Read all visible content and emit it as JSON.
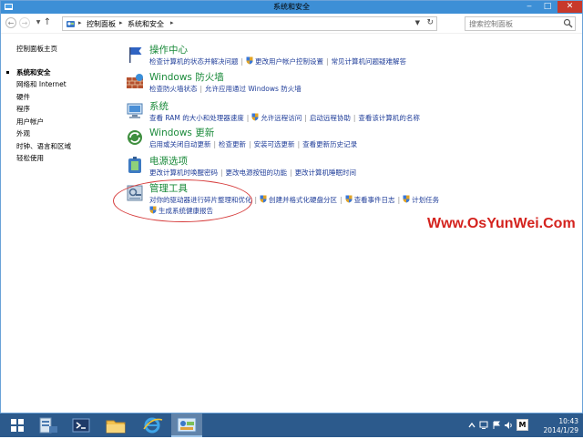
{
  "window": {
    "title": "系统和安全"
  },
  "address": {
    "crumbs": [
      "控制面板",
      "系统和安全"
    ],
    "search_placeholder": "搜索控制面板"
  },
  "sidebar": {
    "items": [
      {
        "label": "控制面板主页",
        "current": false
      },
      {
        "label": "系统和安全",
        "current": true
      },
      {
        "label": "网络和 Internet",
        "current": false
      },
      {
        "label": "硬件",
        "current": false
      },
      {
        "label": "程序",
        "current": false
      },
      {
        "label": "用户帐户",
        "current": false
      },
      {
        "label": "外观",
        "current": false
      },
      {
        "label": "时钟、语言和区域",
        "current": false
      },
      {
        "label": "轻松使用",
        "current": false
      }
    ]
  },
  "categories": [
    {
      "title": "操作中心",
      "icon": "flag-icon",
      "links": [
        {
          "text": "检查计算机的状态并解决问题",
          "shield": false
        },
        {
          "text": "更改用户帐户控制设置",
          "shield": true
        },
        {
          "text": "常见计算机问题疑难解答",
          "shield": false
        }
      ]
    },
    {
      "title": "Windows 防火墙",
      "icon": "firewall-icon",
      "links": [
        {
          "text": "检查防火墙状态",
          "shield": false
        },
        {
          "text": "允许应用通过 Windows 防火墙",
          "shield": false
        }
      ]
    },
    {
      "title": "系统",
      "icon": "computer-icon",
      "links": [
        {
          "text": "查看 RAM 的大小和处理器速度",
          "shield": false
        },
        {
          "text": "允许远程访问",
          "shield": true
        },
        {
          "text": "启动远程协助",
          "shield": false
        },
        {
          "text": "查看该计算机的名称",
          "shield": false
        }
      ]
    },
    {
      "title": "Windows 更新",
      "icon": "update-icon",
      "links": [
        {
          "text": "启用或关闭自动更新",
          "shield": false
        },
        {
          "text": "检查更新",
          "shield": false
        },
        {
          "text": "安装可选更新",
          "shield": false
        },
        {
          "text": "查看更新历史记录",
          "shield": false
        }
      ]
    },
    {
      "title": "电源选项",
      "icon": "power-icon",
      "links": [
        {
          "text": "更改计算机时唤醒密码",
          "shield": false
        },
        {
          "text": "更改电源按钮的功能",
          "shield": false
        },
        {
          "text": "更改计算机睡眠时间",
          "shield": false
        }
      ]
    },
    {
      "title": "管理工具",
      "icon": "admin-tools-icon",
      "links": [
        {
          "text": "对你的驱动器进行碎片整理和优化",
          "shield": false
        },
        {
          "text": "创建并格式化硬盘分区",
          "shield": true
        },
        {
          "text": "查看事件日志",
          "shield": true
        },
        {
          "text": "计划任务",
          "shield": true
        }
      ],
      "links_line2": [
        {
          "text": "生成系统健康报告",
          "shield": true
        }
      ]
    }
  ],
  "watermark": "Www.OsYunWei.Com",
  "taskbar": {
    "items": [
      "start-icon",
      "server-manager-icon",
      "powershell-icon",
      "explorer-icon",
      "internet-explorer-icon",
      "control-panel-icon"
    ],
    "ime": "M",
    "time": "10:43",
    "date": "2014/1/29"
  },
  "colors": {
    "heading": "#1a8a3a",
    "link": "#1f3d99",
    "titlebar": "#3d8fd6",
    "taskbar": "#2c5a8c",
    "watermark": "#d4231e"
  }
}
